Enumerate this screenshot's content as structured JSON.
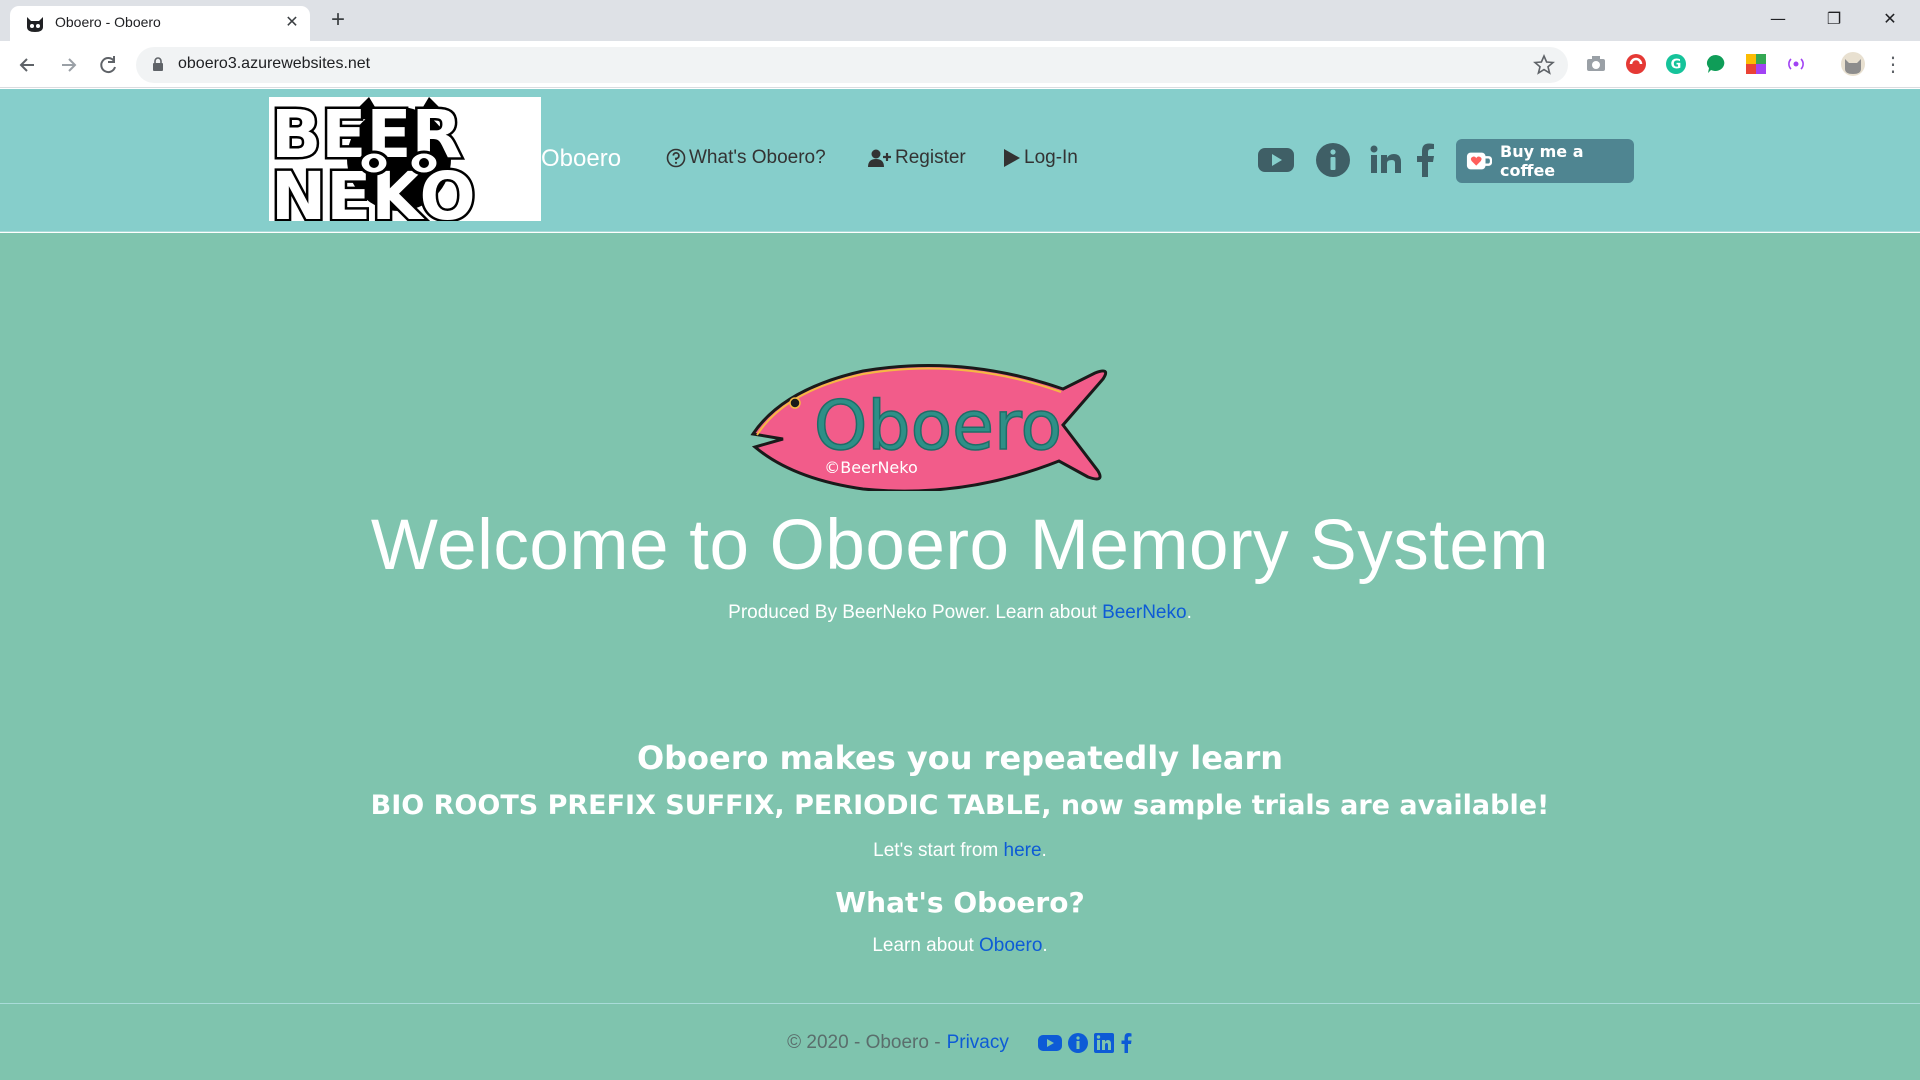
{
  "browser": {
    "tab_title": "Oboero - Oboero",
    "tab_close": "✕",
    "new_tab": "+",
    "url": "oboero3.azurewebsites.net",
    "window_controls": {
      "minimize": "—",
      "restore": "❐",
      "close": "✕"
    }
  },
  "header": {
    "brand": "Oboero",
    "nav": [
      {
        "label": "What's Oboero?",
        "icon": "question-circle-icon"
      },
      {
        "label": "Register",
        "icon": "user-plus-icon"
      },
      {
        "label": "Log-In",
        "icon": "play-icon"
      }
    ],
    "social": [
      "youtube-icon",
      "info-icon",
      "linkedin-icon",
      "facebook-icon"
    ],
    "coffee_button": "Buy me a coffee"
  },
  "main": {
    "fish_logo": {
      "text": "Oboero",
      "copyright": "©BeerNeko"
    },
    "welcome": "Welcome to Oboero Memory System",
    "produced_prefix": "Produced By BeerNeko Power. Learn about ",
    "produced_link": "BeerNeko",
    "produced_suffix": ".",
    "learn_heading": "Oboero makes you repeatedly learn",
    "trials_heading": "BIO ROOTS PREFIX SUFFIX, PERIODIC TABLE, now sample trials are available!",
    "start_prefix": "Let's start from ",
    "start_link": "here",
    "start_suffix": ".",
    "whats_heading": "What's Oboero?",
    "learn_prefix": "Learn about ",
    "learn_link": "Oboero",
    "learn_suffix": "."
  },
  "footer": {
    "copyright": "© 2020 - Oboero - ",
    "privacy": "Privacy"
  },
  "colors": {
    "header_bg": "#86cecb",
    "main_bg": "#7fc4ae",
    "link": "#0d5bd6",
    "coffee_button_bg": "#4f8591",
    "fish_pink": "#f25c8a",
    "fish_text": "#2e8f87"
  }
}
